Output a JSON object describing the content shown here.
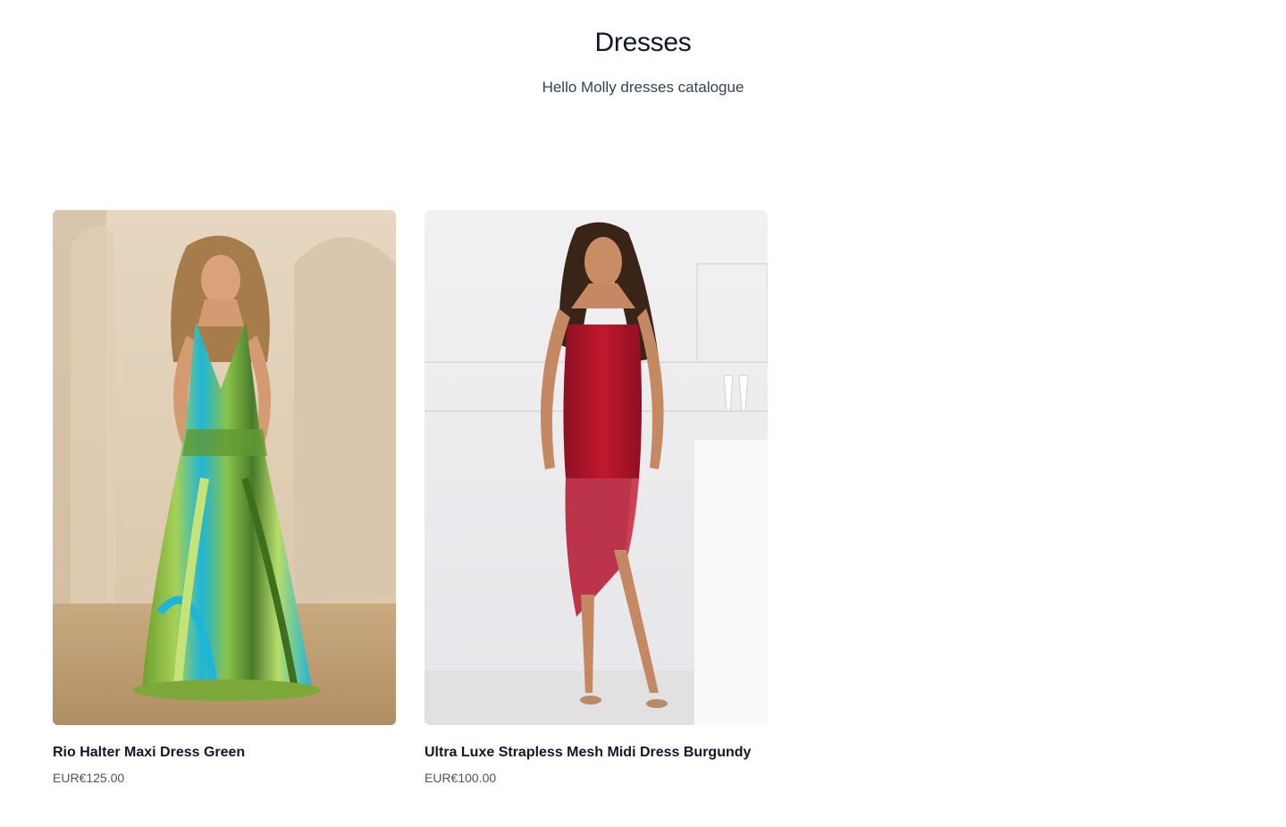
{
  "header": {
    "title": "Dresses",
    "subtitle": "Hello Molly dresses catalogue"
  },
  "products": [
    {
      "name": "Rio Halter Maxi Dress Green",
      "price": "EUR€125.00",
      "image_alt": "Rio Halter Maxi Dress Green",
      "dress_color": "#8bc34a",
      "accent_color": "#1fb5d6"
    },
    {
      "name": "Ultra Luxe Strapless Mesh Midi Dress Burgundy",
      "price": "EUR€100.00",
      "image_alt": "Ultra Luxe Strapless Mesh Midi Dress Burgundy",
      "dress_color": "#b3142b",
      "accent_color": "#d94a5c"
    }
  ]
}
